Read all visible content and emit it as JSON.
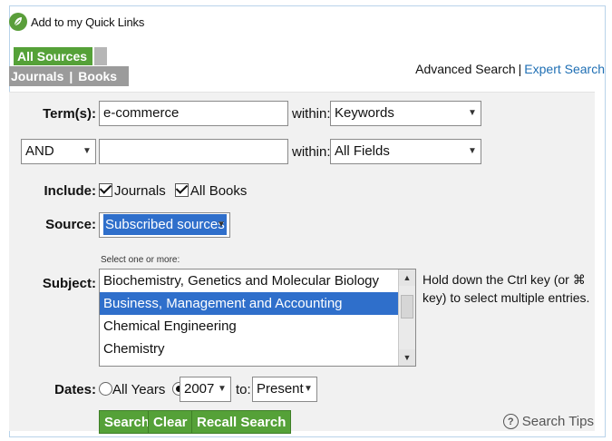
{
  "quick_links": {
    "label": "Add to my Quick Links",
    "icon": "leaf-logo-icon"
  },
  "tabs": {
    "all_sources": "All Sources",
    "journals": "Journals",
    "separator": "|",
    "books": "Books"
  },
  "search_links": {
    "advanced": "Advanced Search",
    "separator": "|",
    "expert": "Expert Search"
  },
  "row1": {
    "label": "Term(s):",
    "value": "e-commerce",
    "within_label": "within:",
    "within_value": "Keywords"
  },
  "row2": {
    "operator": "AND",
    "value": "",
    "within_label": "within:",
    "within_value": "All Fields"
  },
  "include": {
    "label": "Include:",
    "journals": "Journals",
    "books": "All Books"
  },
  "source": {
    "label": "Source:",
    "value": "Subscribed sources"
  },
  "subject": {
    "hint": "Select one or more:",
    "label": "Subject:",
    "items": [
      "Biochemistry, Genetics and Molecular Biology",
      "Business, Management and Accounting",
      "Chemical Engineering",
      "Chemistry"
    ],
    "selected_index": 1,
    "help": "Hold down the Ctrl key (or ⌘ key) to select multiple entries."
  },
  "dates": {
    "label": "Dates:",
    "all_years": "All Years",
    "from": "2007",
    "to_label": "to:",
    "to": "Present"
  },
  "buttons": {
    "search": "Search",
    "clear": "Clear",
    "recall": "Recall Search"
  },
  "search_tips": "Search Tips",
  "colors": {
    "accent_green": "#55a138",
    "link_blue": "#1f6fb4",
    "selection_blue": "#2f6fcb",
    "tab_gray": "#9b9b9b"
  }
}
